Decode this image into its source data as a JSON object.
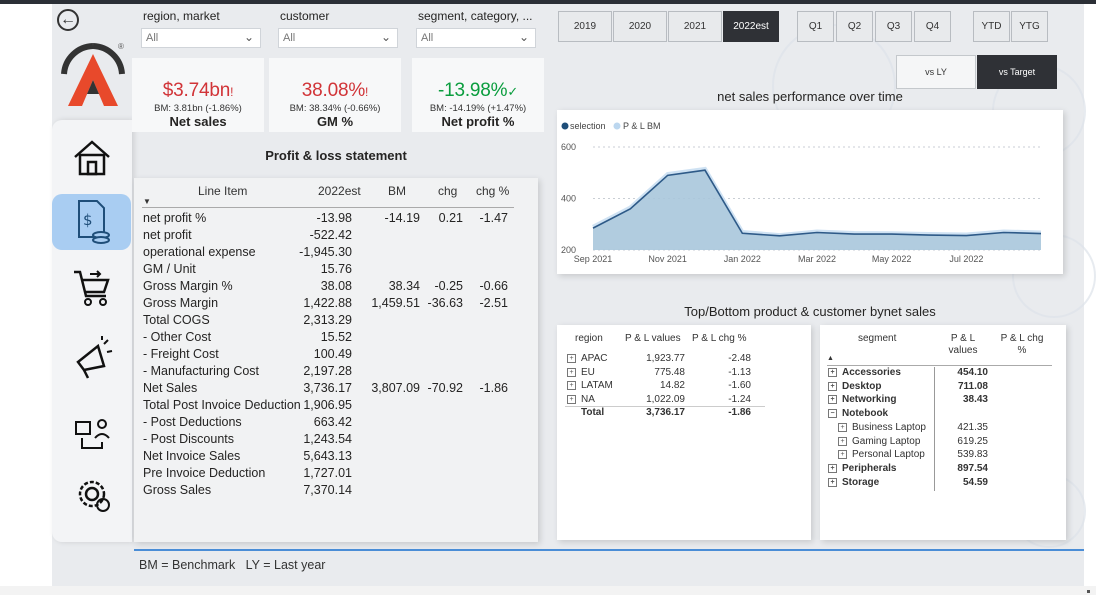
{
  "filters": [
    {
      "label": "region, market",
      "value": "All"
    },
    {
      "label": "customer",
      "value": "All"
    },
    {
      "label": "segment, category, ...",
      "value": "All"
    }
  ],
  "kpis": [
    {
      "value": "$3.74bn",
      "flag": "!",
      "benchmark": "BM: 3.81bn (-1.86%)",
      "name": "Net sales",
      "status": "negative"
    },
    {
      "value": "38.08%",
      "flag": "!",
      "benchmark": "BM: 38.34% (-0.66%)",
      "name": "GM %",
      "status": "negative"
    },
    {
      "value": "-13.98%",
      "flag": "✓",
      "benchmark": "BM: -14.19% (+1.47%)",
      "name": "Net profit %",
      "status": "positive"
    }
  ],
  "colors": {
    "negative": "#d13438",
    "positive": "#0a9d3e",
    "accent": "#4a8dd6",
    "active_nav": "#a9cdf2",
    "area_fill": "#a9c7dc",
    "line": "#2e5a88"
  },
  "pnl": {
    "title": "Profit & loss statement",
    "columns": [
      "Line Item",
      "2022est",
      "BM",
      "chg",
      "chg %"
    ],
    "rows": [
      {
        "item": "net profit %",
        "est": "-13.98",
        "bm": "-14.19",
        "chg": "0.21",
        "chgp": "-1.47"
      },
      {
        "item": "net profit",
        "est": "-522.42",
        "bm": "",
        "chg": "",
        "chgp": ""
      },
      {
        "item": "operational expense",
        "est": "-1,945.30",
        "bm": "",
        "chg": "",
        "chgp": ""
      },
      {
        "item": "GM / Unit",
        "est": "15.76",
        "bm": "",
        "chg": "",
        "chgp": ""
      },
      {
        "item": "Gross Margin %",
        "est": "38.08",
        "bm": "38.34",
        "chg": "-0.25",
        "chgp": "-0.66"
      },
      {
        "item": "Gross Margin",
        "est": "1,422.88",
        "bm": "1,459.51",
        "chg": "-36.63",
        "chgp": "-2.51"
      },
      {
        "item": "Total COGS",
        "est": "2,313.29",
        "bm": "",
        "chg": "",
        "chgp": ""
      },
      {
        "item": "- Other Cost",
        "est": "15.52",
        "bm": "",
        "chg": "",
        "chgp": ""
      },
      {
        "item": "- Freight Cost",
        "est": "100.49",
        "bm": "",
        "chg": "",
        "chgp": ""
      },
      {
        "item": "- Manufacturing Cost",
        "est": "2,197.28",
        "bm": "",
        "chg": "",
        "chgp": ""
      },
      {
        "item": "Net Sales",
        "est": "3,736.17",
        "bm": "3,807.09",
        "chg": "-70.92",
        "chgp": "-1.86"
      },
      {
        "item": "Total Post Invoice Deduction",
        "est": "1,906.95",
        "bm": "",
        "chg": "",
        "chgp": ""
      },
      {
        "item": "- Post Deductions",
        "est": "663.42",
        "bm": "",
        "chg": "",
        "chgp": ""
      },
      {
        "item": "- Post Discounts",
        "est": "1,243.54",
        "bm": "",
        "chg": "",
        "chgp": ""
      },
      {
        "item": "Net Invoice Sales",
        "est": "5,643.13",
        "bm": "",
        "chg": "",
        "chgp": ""
      },
      {
        "item": "Pre Invoice Deduction",
        "est": "1,727.01",
        "bm": "",
        "chg": "",
        "chgp": ""
      },
      {
        "item": "Gross Sales",
        "est": "7,370.14",
        "bm": "",
        "chg": "",
        "chgp": ""
      }
    ]
  },
  "period_buttons": {
    "years": [
      "2019",
      "2020",
      "2021",
      "2022est"
    ],
    "selected_year": "2022est",
    "quarters": [
      "Q1",
      "Q2",
      "Q3",
      "Q4"
    ],
    "ytd": [
      "YTD",
      "YTG"
    ],
    "compare": [
      "vs LY",
      "vs Target"
    ],
    "selected_compare": "vs Target"
  },
  "chart": {
    "title": "net sales performance over time"
  },
  "chart_data": {
    "type": "area",
    "title": "net sales performance over time",
    "series": [
      {
        "name": "selection",
        "values": [
          285,
          360,
          490,
          510,
          265,
          255,
          268,
          262,
          262,
          258,
          256,
          268,
          264
        ]
      },
      {
        "name": "P & L BM",
        "values": [
          290,
          365,
          495,
          515,
          270,
          258,
          272,
          266,
          265,
          262,
          260,
          272,
          268
        ]
      }
    ],
    "x": [
      "Sep 2021",
      "Oct 2021",
      "Nov 2021",
      "Dec 2021",
      "Jan 2022",
      "Feb 2022",
      "Mar 2022",
      "Apr 2022",
      "May 2022",
      "Jun 2022",
      "Jul 2022",
      "Aug 2022",
      "Aug 2022b"
    ],
    "x_ticks": [
      "Sep 2021",
      "Nov 2021",
      "Jan 2022",
      "Mar 2022",
      "May 2022",
      "Jul 2022"
    ],
    "y_ticks": [
      "200",
      "400",
      "600"
    ],
    "ylim": [
      200,
      600
    ],
    "legend": "top-left",
    "grid": true
  },
  "topbottom": {
    "title": "Top/Bottom product & customer bynet sales",
    "region": {
      "headers": [
        "region",
        "P & L values",
        "P & L chg %"
      ],
      "rows": [
        {
          "name": "APAC",
          "value": "1,923.77",
          "chg": "-2.48"
        },
        {
          "name": "EU",
          "value": "775.48",
          "chg": "-1.13"
        },
        {
          "name": "LATAM",
          "value": "14.82",
          "chg": "-1.60"
        },
        {
          "name": "NA",
          "value": "1,022.09",
          "chg": "-1.24"
        }
      ],
      "total": {
        "name": "Total",
        "value": "3,736.17",
        "chg": "-1.86"
      }
    },
    "segment": {
      "headers": [
        "segment",
        "P & L values",
        "P & L chg %"
      ],
      "rows": [
        {
          "name": "Accessories",
          "value": "454.10",
          "bold": true,
          "indent": false,
          "exp": "+"
        },
        {
          "name": "Desktop",
          "value": "711.08",
          "bold": true,
          "indent": false,
          "exp": "+"
        },
        {
          "name": "Networking",
          "value": "38.43",
          "bold": true,
          "indent": false,
          "exp": "+"
        },
        {
          "name": "Notebook",
          "value": "",
          "bold": true,
          "indent": false,
          "exp": "−"
        },
        {
          "name": "Business Laptop",
          "value": "421.35",
          "bold": false,
          "indent": true,
          "exp": "+"
        },
        {
          "name": "Gaming Laptop",
          "value": "619.25",
          "bold": false,
          "indent": true,
          "exp": "+"
        },
        {
          "name": "Personal Laptop",
          "value": "539.83",
          "bold": false,
          "indent": true,
          "exp": "+"
        },
        {
          "name": "Peripherals",
          "value": "897.54",
          "bold": true,
          "indent": false,
          "exp": "+"
        },
        {
          "name": "Storage",
          "value": "54.59",
          "bold": true,
          "indent": false,
          "exp": "+"
        }
      ]
    }
  },
  "footer": "BM = Benchmark   LY = Last year"
}
